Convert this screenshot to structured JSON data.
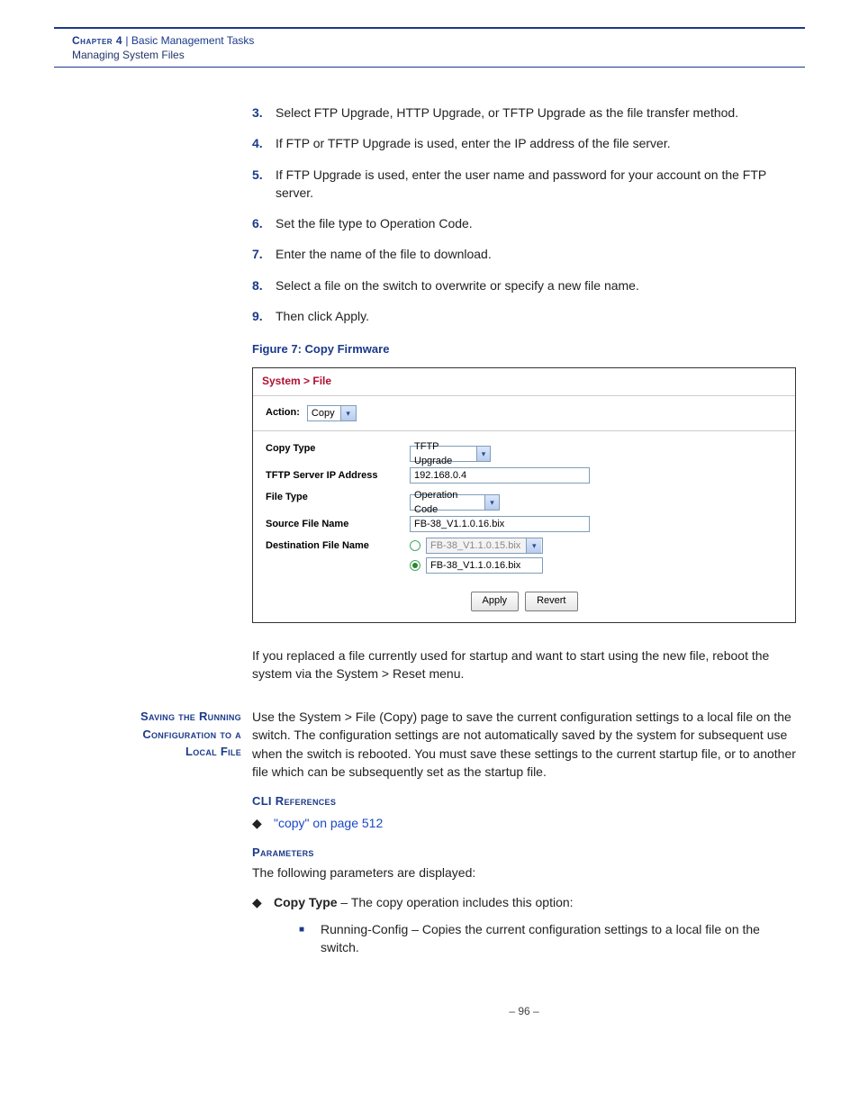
{
  "header": {
    "chapter_label": "Chapter 4",
    "separator": "|",
    "title": "Basic Management Tasks",
    "subtitle": "Managing System Files"
  },
  "steps": [
    {
      "n": "3.",
      "t": "Select FTP Upgrade, HTTP Upgrade, or TFTP Upgrade as the file transfer method."
    },
    {
      "n": "4.",
      "t": "If FTP or TFTP Upgrade is used, enter the IP address of the file server."
    },
    {
      "n": "5.",
      "t": "If FTP Upgrade is used, enter the user name and password for your account on the FTP server."
    },
    {
      "n": "6.",
      "t": "Set the file type to Operation Code."
    },
    {
      "n": "7.",
      "t": "Enter the name of the file to download."
    },
    {
      "n": "8.",
      "t": "Select a file on the switch to overwrite or specify a new file name."
    },
    {
      "n": "9.",
      "t": "Then click Apply."
    }
  ],
  "figure_caption": "Figure 7:  Copy Firmware",
  "panel": {
    "breadcrumb": "System > File",
    "action_label": "Action:",
    "action_value": "Copy",
    "rows": {
      "copy_type_label": "Copy Type",
      "copy_type_value": "TFTP Upgrade",
      "ip_label": "TFTP Server IP Address",
      "ip_value": "192.168.0.4",
      "file_type_label": "File Type",
      "file_type_value": "Operation Code",
      "source_label": "Source File Name",
      "source_value": "FB-38_V1.1.0.16.bix",
      "dest_label": "Destination File Name",
      "dest_opt1": "FB-38_V1.1.0.15.bix",
      "dest_opt2": "FB-38_V1.1.0.16.bix"
    },
    "buttons": {
      "apply": "Apply",
      "revert": "Revert"
    }
  },
  "after_figure_para": "If you replaced a file currently used for startup and want to start using the new file, reboot the system via the System > Reset menu.",
  "section": {
    "side_heading_l1": "Saving the Running",
    "side_heading_l2": "Configuration to a",
    "side_heading_l3": "Local File",
    "body": "Use the System > File (Copy) page to save the current configuration settings to a local file on the switch. The configuration settings are not automatically saved by the system for subsequent use when the switch is rebooted. You must save these settings to the current startup file, or to another file which can be subsequently set as the startup file.",
    "cli_head": "CLI References",
    "cli_link": "\"copy\" on page 512",
    "params_head": "Parameters",
    "params_intro": "The following parameters are displayed:",
    "param_name": "Copy Type",
    "param_desc": " – The copy operation includes this option:",
    "sub_param": "Running-Config – Copies the current configuration settings to a local file on the switch."
  },
  "footer": "–  96  –",
  "glyphs": {
    "down": "▾",
    "diamond": "◆",
    "square": "■"
  }
}
